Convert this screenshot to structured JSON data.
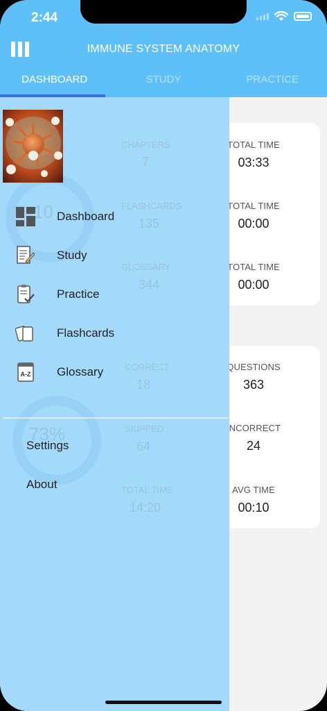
{
  "status_bar": {
    "time": "2:44"
  },
  "header": {
    "title": "IMMUNE SYSTEM ANATOMY"
  },
  "tabs": [
    {
      "label": "DASHBOARD"
    },
    {
      "label": "STUDY"
    },
    {
      "label": "PRACTICE"
    }
  ],
  "cards": [
    {
      "stats": [
        {
          "label": "TOTAL TIME",
          "value": "03:33"
        },
        {
          "label": "TOTAL TIME",
          "value": "00:00"
        },
        {
          "label": "TOTAL TIME",
          "value": "00:00"
        }
      ]
    },
    {
      "stats": [
        {
          "label": "QUESTIONS",
          "value": "363"
        },
        {
          "label": "INCORRECT",
          "value": "24"
        },
        {
          "label": "AVG TIME",
          "value": "00:10"
        }
      ]
    }
  ],
  "background_faded": {
    "items": [
      {
        "label": "CHAPTERS",
        "value": "7"
      },
      {
        "label": "FLASHCARDS",
        "value": "135"
      },
      {
        "label": "GLOSSARY",
        "value": "344"
      },
      {
        "label": "CORRECT",
        "value": "18"
      },
      {
        "label": "SKIPPED",
        "value": "64"
      },
      {
        "label": "TOTAL TIME",
        "value": "14:20"
      }
    ],
    "percent_top": "10",
    "percent_bottom": "73%"
  },
  "drawer": {
    "items": [
      {
        "label": "Dashboard",
        "icon": "dashboard-icon"
      },
      {
        "label": "Study",
        "icon": "study-icon"
      },
      {
        "label": "Practice",
        "icon": "practice-icon"
      },
      {
        "label": "Flashcards",
        "icon": "flashcards-icon"
      },
      {
        "label": "Glossary",
        "icon": "glossary-icon"
      }
    ],
    "secondary": [
      {
        "label": "Settings"
      },
      {
        "label": "About"
      }
    ]
  },
  "colors": {
    "header": "#5ec0f8",
    "drawer": "#a0d8fa",
    "tab_indicator": "#3b6fd9"
  }
}
